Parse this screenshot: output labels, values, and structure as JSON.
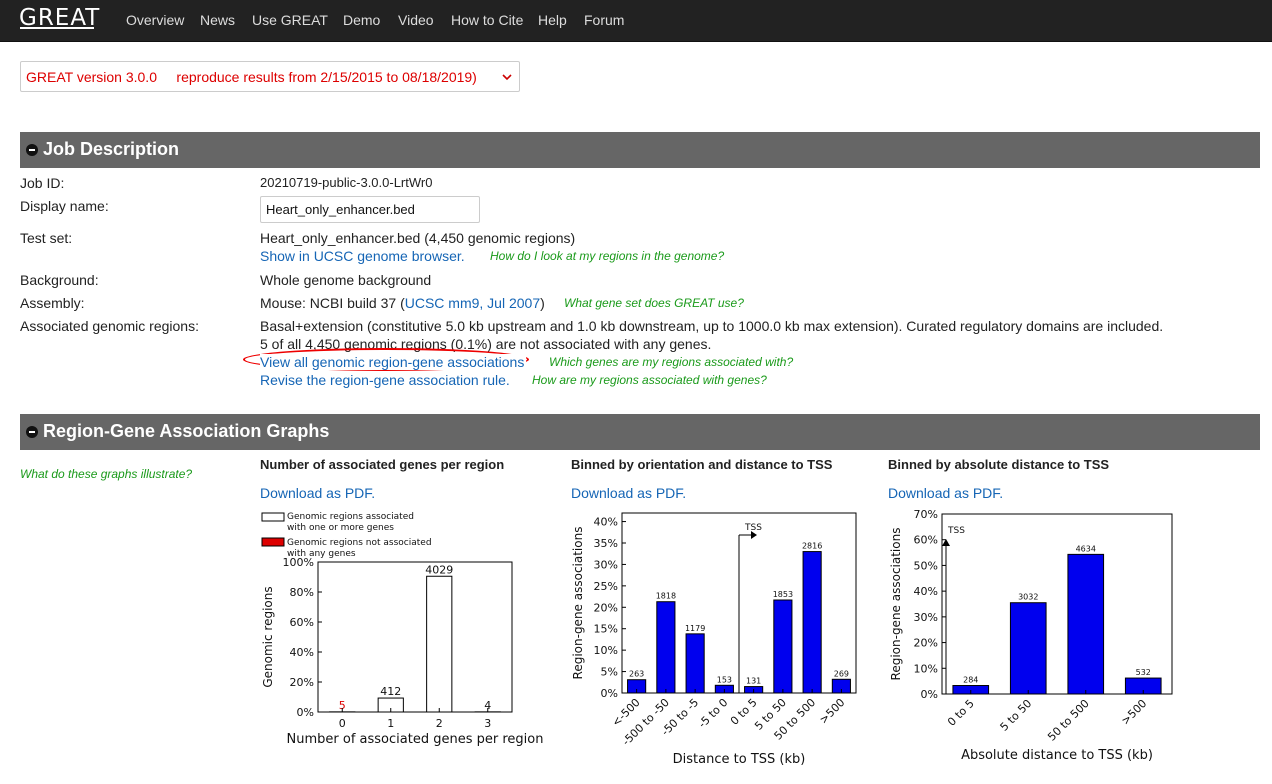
{
  "nav": {
    "brand": "GREAT",
    "items": [
      "Overview",
      "News",
      "Use GREAT",
      "Demo",
      "Video",
      "How to Cite",
      "Help",
      "Forum"
    ]
  },
  "version": {
    "selected": "GREAT version 3.0.0     reproduce results from 2/15/2015 to 08/18/2019)"
  },
  "job": {
    "header": "Job Description",
    "job_id_label": "Job ID:",
    "job_id": "20210719-public-3.0.0-LrtWr0",
    "display_name_label": "Display name:",
    "display_name": "Heart_only_enhancer.bed",
    "test_set_label": "Test set:",
    "test_set": "Heart_only_enhancer.bed (4,450 genomic regions)",
    "ucsc_link": "Show in UCSC genome browser.",
    "ucsc_help": "How do I look at my regions in the genome?",
    "background_label": "Background:",
    "background": "Whole genome background",
    "assembly_label": "Assembly:",
    "assembly_prefix": "Mouse: NCBI build 37 (",
    "assembly_link": "UCSC mm9, Jul 2007",
    "assembly_suffix": ")",
    "assembly_help": "What gene set does GREAT use?",
    "assoc_label": "Associated genomic regions:",
    "assoc_rule": "Basal+extension (constitutive 5.0 kb upstream and 1.0 kb downstream, up to 1000.0 kb max extension). Curated regulatory domains are included.",
    "assoc_note": "5 of all 4,450 genomic regions (0.1%) are not associated with any genes.",
    "view_link": "View all genomic region-gene associations",
    "view_help": "Which genes are my regions associated with?",
    "revise_link": "Revise the region-gene association rule.",
    "revise_help": "How are my regions associated with genes?"
  },
  "graphs": {
    "header": "Region-Gene Association Graphs",
    "help": "What do these graphs illustrate?",
    "download": "Download as PDF.",
    "g1_title": "Number of associated genes per region",
    "g2_title": "Binned by orientation and distance to TSS",
    "g3_title": "Binned by absolute distance to TSS"
  },
  "colors": {
    "bar_blue": "#0000ee",
    "missing_red": "#dd0000",
    "nav_bg": "#222222",
    "section_bg": "#666666",
    "link": "#1565b5",
    "help_green": "#1a9a1a"
  },
  "chart_data": [
    {
      "type": "bar",
      "ylabel": "Genomic regions",
      "xlabel": "Number of associated genes per region",
      "categories": [
        "0",
        "1",
        "2",
        "3"
      ],
      "values": [
        0.1,
        9.3,
        90.5,
        0.1
      ],
      "labels": [
        "5",
        "412",
        "4029",
        "4"
      ],
      "ylim": [
        0,
        100
      ],
      "yticks": [
        "0%",
        "20%",
        "40%",
        "60%",
        "80%",
        "100%"
      ],
      "legend": [
        "Genomic regions associated with one or more genes",
        "Genomic regions not associated with any genes"
      ]
    },
    {
      "type": "bar",
      "ylabel": "Region-gene associations",
      "xlabel": "Distance to TSS (kb)",
      "categories": [
        "<-500",
        "-500 to -50",
        "-50 to -5",
        "-5 to 0",
        "0 to 5",
        "5 to 50",
        "50 to 500",
        ">500"
      ],
      "values": [
        3.1,
        21.3,
        13.8,
        1.8,
        1.5,
        21.7,
        33.0,
        3.2
      ],
      "labels": [
        "263",
        "1818",
        "1179",
        "153",
        "131",
        "1853",
        "2816",
        "269"
      ],
      "ylim": [
        0,
        42
      ],
      "yticks": [
        "0%",
        "5%",
        "10%",
        "15%",
        "20%",
        "25%",
        "30%",
        "35%",
        "40%"
      ],
      "annotation": "TSS"
    },
    {
      "type": "bar",
      "ylabel": "Region-gene associations",
      "xlabel": "Absolute distance to TSS (kb)",
      "categories": [
        "0 to 5",
        "5 to 50",
        "50 to 500",
        ">500"
      ],
      "values": [
        3.3,
        35.5,
        54.3,
        6.2
      ],
      "labels": [
        "284",
        "3032",
        "4634",
        "532"
      ],
      "ylim": [
        0,
        70
      ],
      "yticks": [
        "0%",
        "10%",
        "20%",
        "30%",
        "40%",
        "50%",
        "60%",
        "70%"
      ],
      "annotation": "TSS"
    }
  ]
}
